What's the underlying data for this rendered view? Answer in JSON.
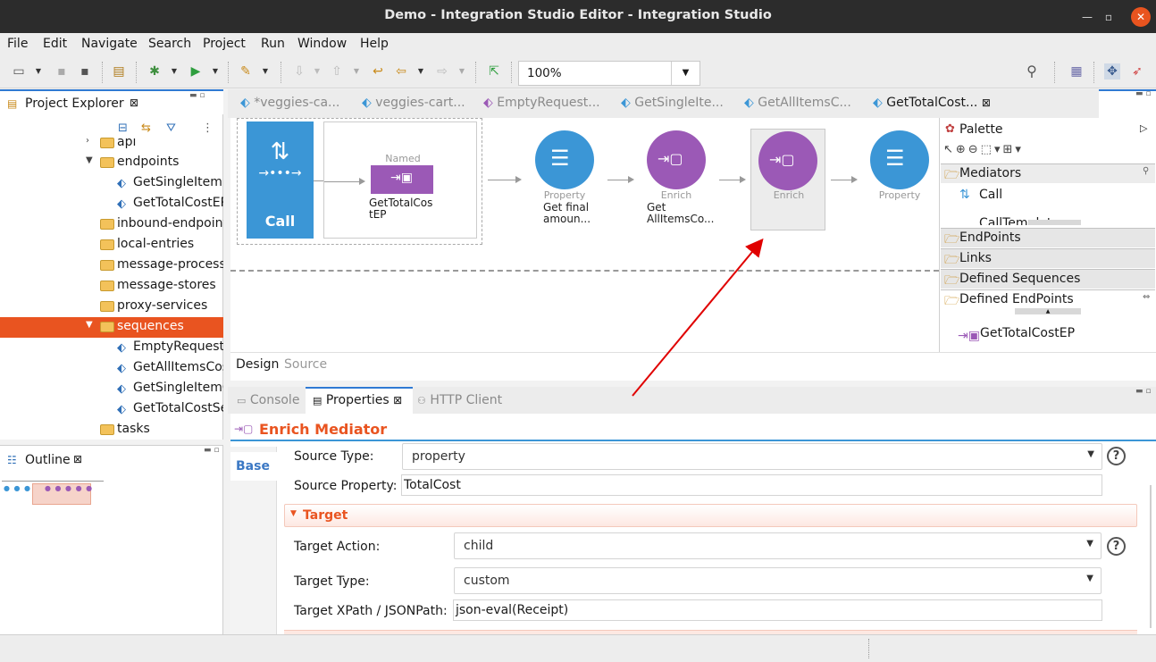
{
  "window": {
    "title": "Demo - Integration Studio Editor - Integration Studio"
  },
  "menu": [
    "File",
    "Edit",
    "Navigate",
    "Search",
    "Project",
    "Run",
    "Window",
    "Help"
  ],
  "toolbar": {
    "zoom": "100%"
  },
  "explorer": {
    "title": "Project Explorer",
    "items": [
      {
        "label": "api",
        "indent": 1,
        "type": "folder"
      },
      {
        "label": "endpoints",
        "indent": 1,
        "type": "folder",
        "expanded": true
      },
      {
        "label": "GetSingleItemEP",
        "indent": 2,
        "type": "file"
      },
      {
        "label": "GetTotalCostEP",
        "indent": 2,
        "type": "file"
      },
      {
        "label": "inbound-endpoints",
        "indent": 1,
        "type": "folder"
      },
      {
        "label": "local-entries",
        "indent": 1,
        "type": "folder"
      },
      {
        "label": "message-processors",
        "indent": 1,
        "type": "folder"
      },
      {
        "label": "message-stores",
        "indent": 1,
        "type": "folder"
      },
      {
        "label": "proxy-services",
        "indent": 1,
        "type": "folder"
      },
      {
        "label": "sequences",
        "indent": 1,
        "type": "folder",
        "expanded": true,
        "selected": true
      },
      {
        "label": "EmptyRequestSeq",
        "indent": 2,
        "type": "file"
      },
      {
        "label": "GetAllItemsCostSeq",
        "indent": 2,
        "type": "file"
      },
      {
        "label": "GetSingleItemCostSeq",
        "indent": 2,
        "type": "file"
      },
      {
        "label": "GetTotalCostSeq",
        "indent": 2,
        "type": "file"
      },
      {
        "label": "tasks",
        "indent": 1,
        "type": "folder"
      }
    ]
  },
  "outline": {
    "title": "Outline"
  },
  "editor": {
    "tabs": [
      {
        "label": "*veggies-ca..."
      },
      {
        "label": "veggies-cart..."
      },
      {
        "label": "EmptyRequest..."
      },
      {
        "label": "GetSingleIte..."
      },
      {
        "label": "GetAllItemsC..."
      },
      {
        "label": "GetTotalCost...",
        "active": true
      }
    ],
    "flow": {
      "call_label": "Call",
      "named_label": "Named",
      "named_value": "GetTotalCostEP",
      "nodes": [
        {
          "type": "Property",
          "sub": "Get final amoun..."
        },
        {
          "type": "Enrich",
          "sub": "Get AllItemsCo..."
        },
        {
          "type": "Enrich",
          "sub": ""
        },
        {
          "type": "Property",
          "sub": ""
        }
      ]
    },
    "bottom_tabs": {
      "design": "Design",
      "source": "Source"
    }
  },
  "palette": {
    "title": "Palette",
    "mediators": "Mediators",
    "call": "Call",
    "calltemplate": "CallTemplate",
    "drawers": [
      "EndPoints",
      "Links",
      "Defined Sequences",
      "Defined EndPoints"
    ],
    "endpoint_item": "GetTotalCostEP"
  },
  "properties": {
    "tabs": [
      "Console",
      "Properties",
      "HTTP Client"
    ],
    "header": "Enrich Mediator",
    "side_tab": "Base",
    "source_type_label": "Source Type:",
    "source_type_value": "property",
    "source_property_label": "Source Property:",
    "source_property_value": "TotalCost",
    "target_section": "Target",
    "target_action_label": "Target Action:",
    "target_action_value": "child",
    "target_type_label": "Target Type:",
    "target_type_value": "custom",
    "target_xpath_label": "Target XPath / JSONPath:",
    "target_xpath_value": "json-eval(Receipt)"
  },
  "colors": {
    "accent": "#e95420",
    "blue_node": "#3b96d6",
    "purple_node": "#9b59b6",
    "arrow": "#e00000"
  }
}
